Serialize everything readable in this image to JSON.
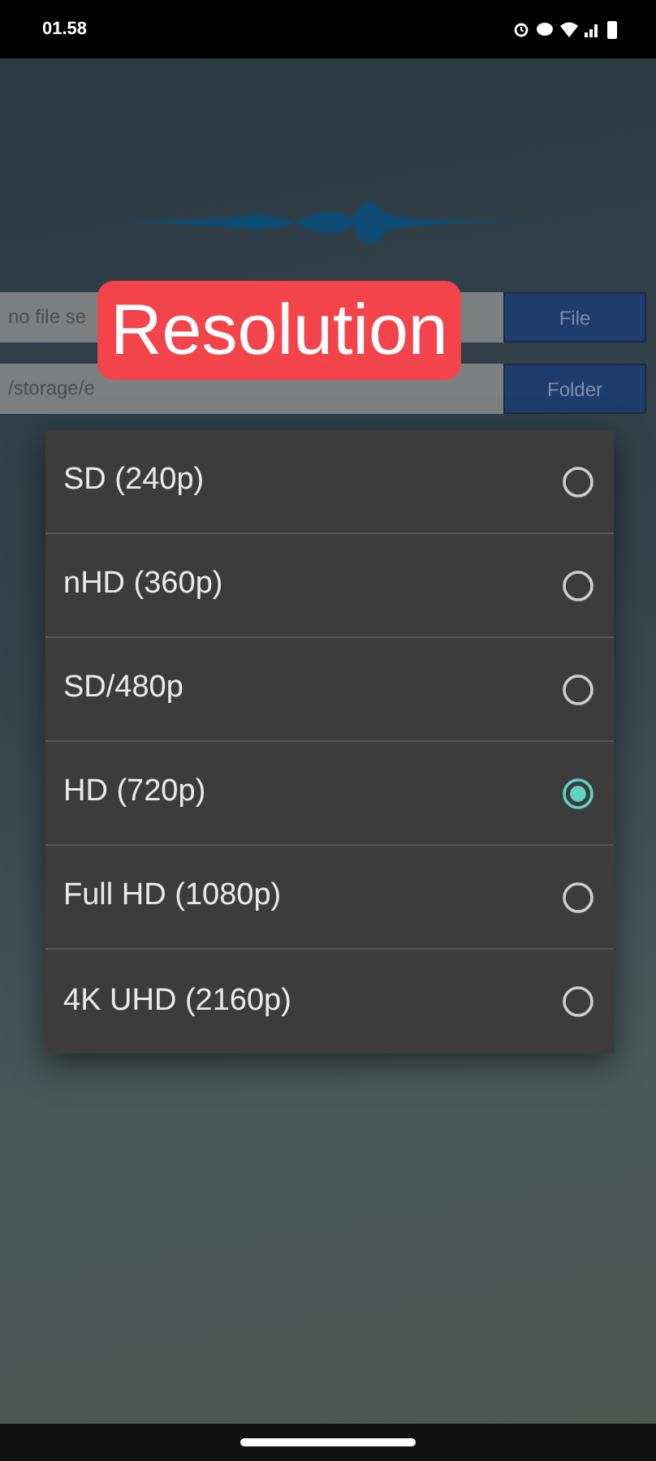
{
  "status_bar": {
    "time": "01.58"
  },
  "file_field": {
    "value": "no file se"
  },
  "file_button": {
    "label": "File"
  },
  "folder_field": {
    "value": "/storage/e"
  },
  "folder_button": {
    "label": "Folder"
  },
  "overlay_label": {
    "text": "Resolution"
  },
  "options": [
    {
      "label": "SD (240p)",
      "selected": false
    },
    {
      "label": "nHD (360p)",
      "selected": false
    },
    {
      "label": "SD/480p",
      "selected": false
    },
    {
      "label": "HD (720p)",
      "selected": true
    },
    {
      "label": "Full HD (1080p)",
      "selected": false
    },
    {
      "label": "4K UHD (2160p)",
      "selected": false
    }
  ]
}
